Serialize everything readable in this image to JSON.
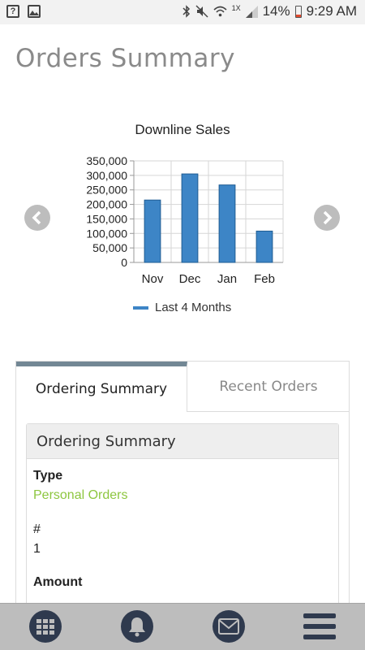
{
  "status_bar": {
    "battery": "14%",
    "time": "9:29 AM",
    "network": "1X"
  },
  "page": {
    "title": "Orders Summary"
  },
  "chart_data": {
    "type": "bar",
    "title": "Downline Sales",
    "categories": [
      "Nov",
      "Dec",
      "Jan",
      "Feb"
    ],
    "series": [
      {
        "name": "Last 4 Months",
        "values": [
          215000,
          305000,
          267000,
          108000
        ]
      }
    ],
    "yticks": [
      "0",
      "50,000",
      "100,000",
      "150,000",
      "200,000",
      "250,000",
      "300,000",
      "350,000"
    ],
    "ylim": [
      0,
      350000
    ],
    "grid": true,
    "legend_position": "bottom",
    "bar_color": "#3d85c6"
  },
  "tabs": [
    {
      "label": "Ordering Summary",
      "active": true
    },
    {
      "label": "Recent Orders",
      "active": false
    }
  ],
  "summary_card": {
    "header": "Ordering Summary",
    "type_label": "Type",
    "type_value": "Personal Orders",
    "count_label": "#",
    "count_value": "1",
    "amount_label": "Amount"
  },
  "colors": {
    "accent_green": "#8dc63f",
    "tab_indicator": "#728794",
    "nav_icon": "#2f3a4e"
  }
}
